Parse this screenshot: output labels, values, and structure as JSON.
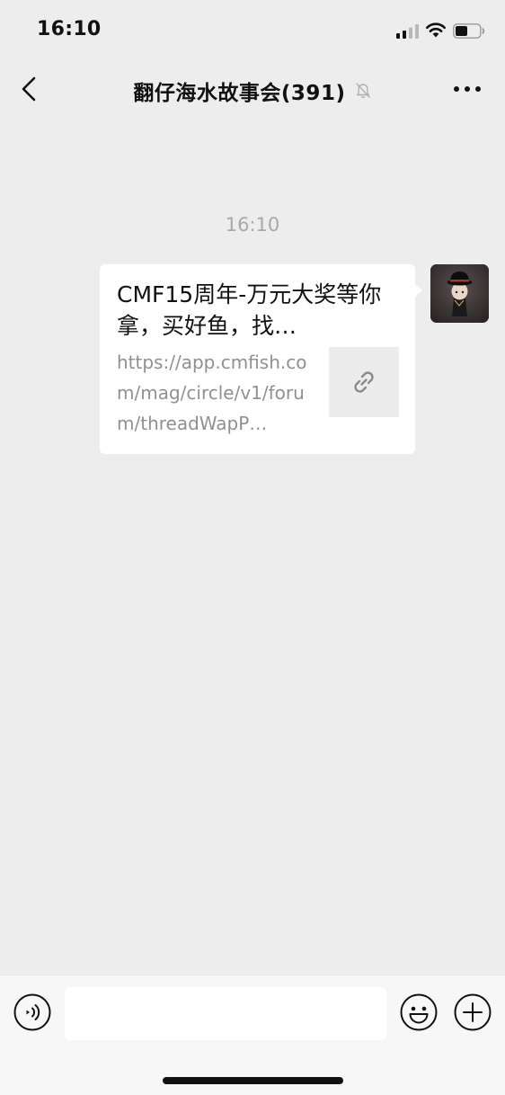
{
  "status_bar": {
    "time": "16:10"
  },
  "nav": {
    "title": "翻仔海水故事会(391)",
    "icons": {
      "back": "chevron-left-icon",
      "mute": "bell-slash-icon",
      "more": "ellipsis-icon"
    }
  },
  "conversation": {
    "timestamp": "16:10",
    "messages": [
      {
        "type": "link-card",
        "sender": "self",
        "title": "CMF15周年-万元大奖等你拿，买好鱼，找…",
        "url_preview": "https://app.cmfish.com/mag/circle/v1/forum/threadWapP…",
        "thumbnail_icon": "link-icon"
      }
    ]
  },
  "input_bar": {
    "text_value": "",
    "placeholder": "",
    "icons": {
      "voice": "voice-icon",
      "emoji": "emoji-icon",
      "plus": "plus-icon"
    }
  },
  "colors": {
    "background": "#ededed",
    "bubble": "#ffffff",
    "secondary_text": "#909090",
    "timestamp_text": "#a9a9a9"
  }
}
